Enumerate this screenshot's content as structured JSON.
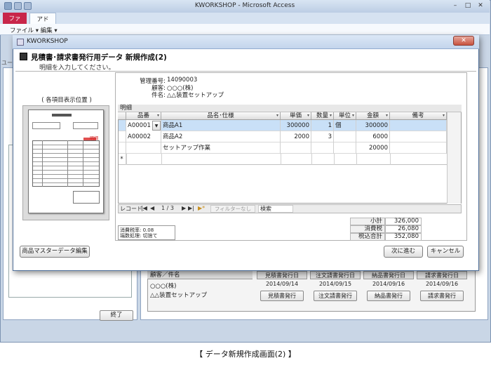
{
  "app": {
    "title": "KWORKSHOP - Microsoft Access",
    "tabs": [
      "ファイル",
      "アドイン"
    ],
    "menu": "ファイル ▾  編集 ▾",
    "exit_button": "終了",
    "left_label": "ユー"
  },
  "background_form": {
    "customer_header": "顧客／件名",
    "customer": "○○○(株)",
    "subject": "△△装置セットアップ",
    "columns": [
      {
        "header": "見積書発行日",
        "date": "2014/09/14",
        "button": "見積書発行"
      },
      {
        "header": "注文請書発行日",
        "date": "2014/09/15",
        "button": "注文請書発行"
      },
      {
        "header": "納品書発行日",
        "date": "2014/09/16",
        "button": "納品書発行"
      },
      {
        "header": "請求書発行日",
        "date": "2014/09/16",
        "button": "請求書発行"
      }
    ]
  },
  "dialog": {
    "window_title": "KWORKSHOP",
    "close_glyph": "✕",
    "heading": "見積書･請求書発行用データ 新規作成(2)",
    "instruction": "明細を入力してください。",
    "preview_caption": "( 各項目表示位置 )",
    "preview_callout": "明細",
    "info": {
      "mgmt_label": "管理番号:",
      "mgmt_value": "14090003",
      "customer_label": "顧客:",
      "customer_value": "○○○(株)",
      "subject_label": "件名:",
      "subject_value": "△△装置セットアップ"
    },
    "subform_caption": "明細",
    "grid": {
      "headers": [
        "品番",
        "品名･仕様",
        "単価",
        "数量",
        "単位",
        "金額",
        "備考"
      ],
      "rows": [
        {
          "code": "A00001",
          "name": "商品A1",
          "price": "300000",
          "qty": "1",
          "unit": "個",
          "amount": "300000",
          "note": ""
        },
        {
          "code": "A00002",
          "name": "商品A2",
          "price": "2000",
          "qty": "3",
          "unit": "",
          "amount": "6000",
          "note": ""
        },
        {
          "code": "",
          "name": "セットアップ作業",
          "price": "",
          "qty": "",
          "unit": "",
          "amount": "20000",
          "note": ""
        }
      ],
      "new_row_marker": "*"
    },
    "nav": {
      "record_label": "レコード:",
      "first": "|◀",
      "prev": "◀",
      "position": "1 / 3",
      "next": "▶",
      "last": "▶|",
      "new": "▶*",
      "filter": "フィルターなし",
      "search": "検索"
    },
    "tax": {
      "rate_line": "消費税率: 0.08",
      "rounding_line": "端数処理: 切捨て"
    },
    "totals": [
      {
        "label": "小計",
        "value": "326,000"
      },
      {
        "label": "消費税",
        "value": "26,080"
      },
      {
        "label": "税込合計",
        "value": "352,080"
      }
    ],
    "buttons": {
      "master_edit": "商品マスターデータ編集",
      "next": "次に進む",
      "cancel": "キャンセル"
    }
  },
  "caption": "【 データ新規作成画面(2) 】"
}
